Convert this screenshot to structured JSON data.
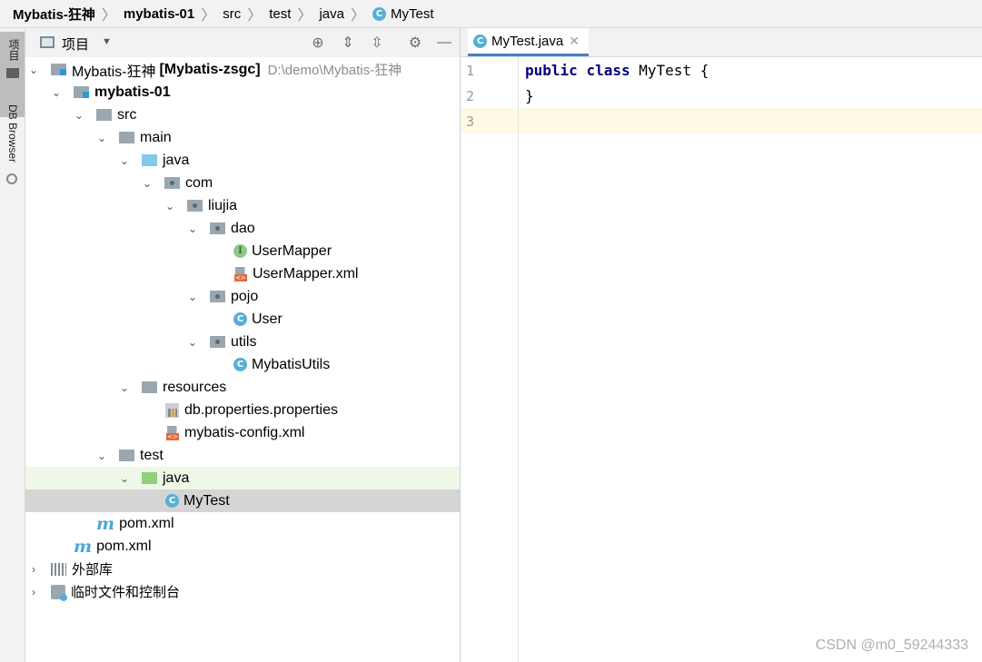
{
  "breadcrumb": {
    "items": [
      "Mybatis-狂神",
      "mybatis-01",
      "src",
      "test",
      "java",
      "MyTest"
    ]
  },
  "toolstrip": {
    "project_label": "项目",
    "db_label": "DB Browser"
  },
  "project_panel": {
    "title": "项目"
  },
  "tree": {
    "root_name": "Mybatis-狂神",
    "root_module": "[Mybatis-zsgc]",
    "root_path": "D:\\demo\\Mybatis-狂神",
    "module": "mybatis-01",
    "src": "src",
    "main": "main",
    "java_main": "java",
    "com": "com",
    "liujia": "liujia",
    "dao": "dao",
    "usermapper": "UserMapper",
    "usermapper_xml": "UserMapper.xml",
    "pojo": "pojo",
    "user": "User",
    "utils": "utils",
    "mybatisutils": "MybatisUtils",
    "resources": "resources",
    "db_properties": "db.properties.properties",
    "mybatis_config": "mybatis-config.xml",
    "test": "test",
    "java_test": "java",
    "mytest": "MyTest",
    "pom_module": "pom.xml",
    "pom_root": "pom.xml",
    "external_libs": "外部库",
    "scratches": "临时文件和控制台"
  },
  "editor": {
    "tab_label": "MyTest.java",
    "line_numbers": [
      "1",
      "2",
      "3"
    ],
    "code": {
      "kw_public": "public",
      "kw_class": "class",
      "class_name": "MyTest",
      "open_brace": "{",
      "close_brace": "}"
    }
  },
  "watermark": "CSDN @m0_59244333",
  "colors": {
    "accent": "#4083c9",
    "current_line": "#fffae3",
    "selection": "#d5d5d5",
    "keyword": "#000080"
  }
}
